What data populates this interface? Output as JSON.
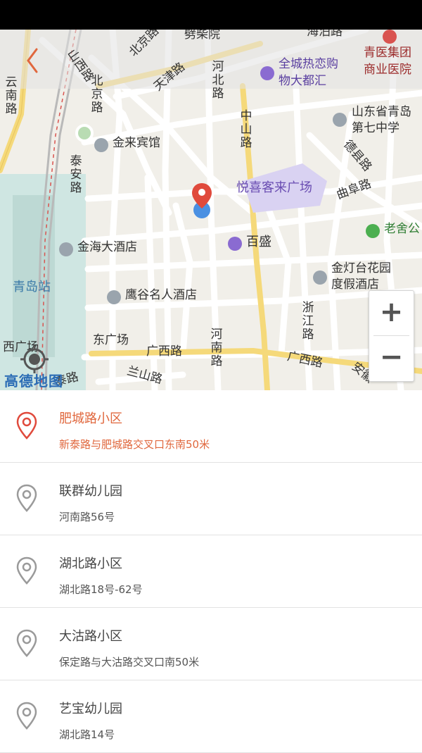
{
  "colors": {
    "accent": "#e0673d",
    "pin_red": "#e04a3c",
    "location_dot": "#4a90e2",
    "road_yellow": "#f5d97a",
    "poi_purple": "#8a6bd1"
  },
  "map": {
    "provider_logo": "高德地图",
    "zoom_in_label": "+",
    "zoom_out_label": "−",
    "labels": {
      "shanxi_road": "山西路",
      "beijing_road_top": "北京路",
      "pichai_yuan": "劈柴院",
      "haibo_road": "海泊路",
      "qingyi_group": "青医集团",
      "commercial_hospital": "商业医院",
      "quancheng_mall_1": "全城热恋购",
      "quancheng_mall_2": "物大都汇",
      "tianjin_road": "天津路",
      "hebei_road": "河北路",
      "yunnan_road": "云南路",
      "beijing_road": "北京路",
      "zhongshan_road": "中山路",
      "shandong_school_1": "山东省青岛",
      "shandong_school_2": "第七中学",
      "jinlai_hotel": "金来宾馆",
      "dexian_road": "德县路",
      "taian_road": "泰安路",
      "yuexi_plaza": "悦喜客来广场",
      "qufu_road": "曲阜路",
      "laoshe_park": "老舍公",
      "jinhai_hotel": "金海大酒店",
      "baisheng": "百盛",
      "qingdao_station": "青岛站",
      "jindengtai_1": "金灯台花园",
      "jindengtai_2": "度假酒店",
      "yinggu_hotel": "鹰谷名人酒店",
      "zhejiang_road": "浙江路",
      "xiguangchang": "西广场",
      "dongguangchang": "东广场",
      "guangxi_road_left": "广西路",
      "henan_road": "河南路",
      "guangxi_road_right": "广西路",
      "anhui_road": "安徽",
      "lanshan_road": "兰山路",
      "tai_road": "泰路"
    }
  },
  "list": [
    {
      "title": "肥城路小区",
      "subtitle": "新泰路与肥城路交叉口东南50米",
      "selected": true
    },
    {
      "title": "联群幼儿园",
      "subtitle": "河南路56号",
      "selected": false
    },
    {
      "title": "湖北路小区",
      "subtitle": "湖北路18号-62号",
      "selected": false
    },
    {
      "title": "大沽路小区",
      "subtitle": "保定路与大沽路交叉口南50米",
      "selected": false
    },
    {
      "title": "艺宝幼儿园",
      "subtitle": "湖北路14号",
      "selected": false
    }
  ]
}
